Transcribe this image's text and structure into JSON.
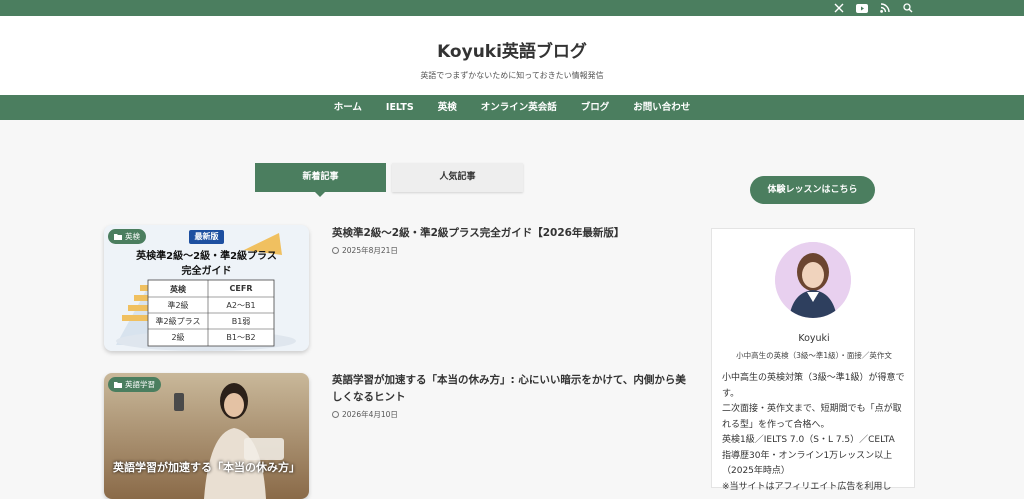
{
  "topbar": {
    "icons": [
      "x-icon",
      "youtube-icon",
      "rss-icon",
      "search-icon"
    ]
  },
  "site": {
    "title": "Koyuki英語ブログ",
    "tagline": "英語でつまずかないために知っておきたい情報発信"
  },
  "nav": {
    "items": [
      "ホーム",
      "IELTS",
      "英検",
      "オンライン英会話",
      "ブログ",
      "お問い合わせ"
    ]
  },
  "tabs": {
    "new_label": "新着記事",
    "popular_label": "人気記事"
  },
  "posts": [
    {
      "category": "英検",
      "title": "英検準2級〜2級・準2級プラス完全ガイド【2026年最新版】",
      "date": "2025年8月21日",
      "thumb": {
        "badge": "最新版",
        "heading1": "英検準2級〜2級・準2級プラス",
        "heading2": "完全ガイド",
        "table_headers": [
          "英検",
          "CEFR"
        ],
        "table_rows": [
          [
            "準2級",
            "A2〜B1"
          ],
          [
            "準2級プラス",
            "B1弱"
          ],
          [
            "2級",
            "B1〜B2"
          ]
        ]
      }
    },
    {
      "category": "英語学習",
      "title": "英語学習が加速する「本当の休み方」: 心にいい暗示をかけて、内側から美しくなるヒント",
      "date": "2026年4月10日",
      "thumb": {
        "caption": "英語学習が加速する「本当の休み方」"
      }
    }
  ],
  "sidebar": {
    "cta_label": "体験レッスンはこちら",
    "name": "Koyuki",
    "role": "小中高生の英検（3級〜準1級）・面接／英作文",
    "desc": [
      "小中高生の英検対策（3級〜準1級）が得意です。",
      "二次面接・英作文まで、短期間でも「点が取れる型」を作って合格へ。",
      "英検1級／IELTS 7.0（S・L 7.5）／CELTA",
      "指導歴30年・オンライン1万レッスン以上（2025年時点）",
      "※当サイトはアフィリエイト広告を利用し"
    ]
  },
  "colors": {
    "brand_green": "#4b7e5f",
    "background": "#f7f7f7",
    "badge_blue": "#1d4fa0"
  }
}
